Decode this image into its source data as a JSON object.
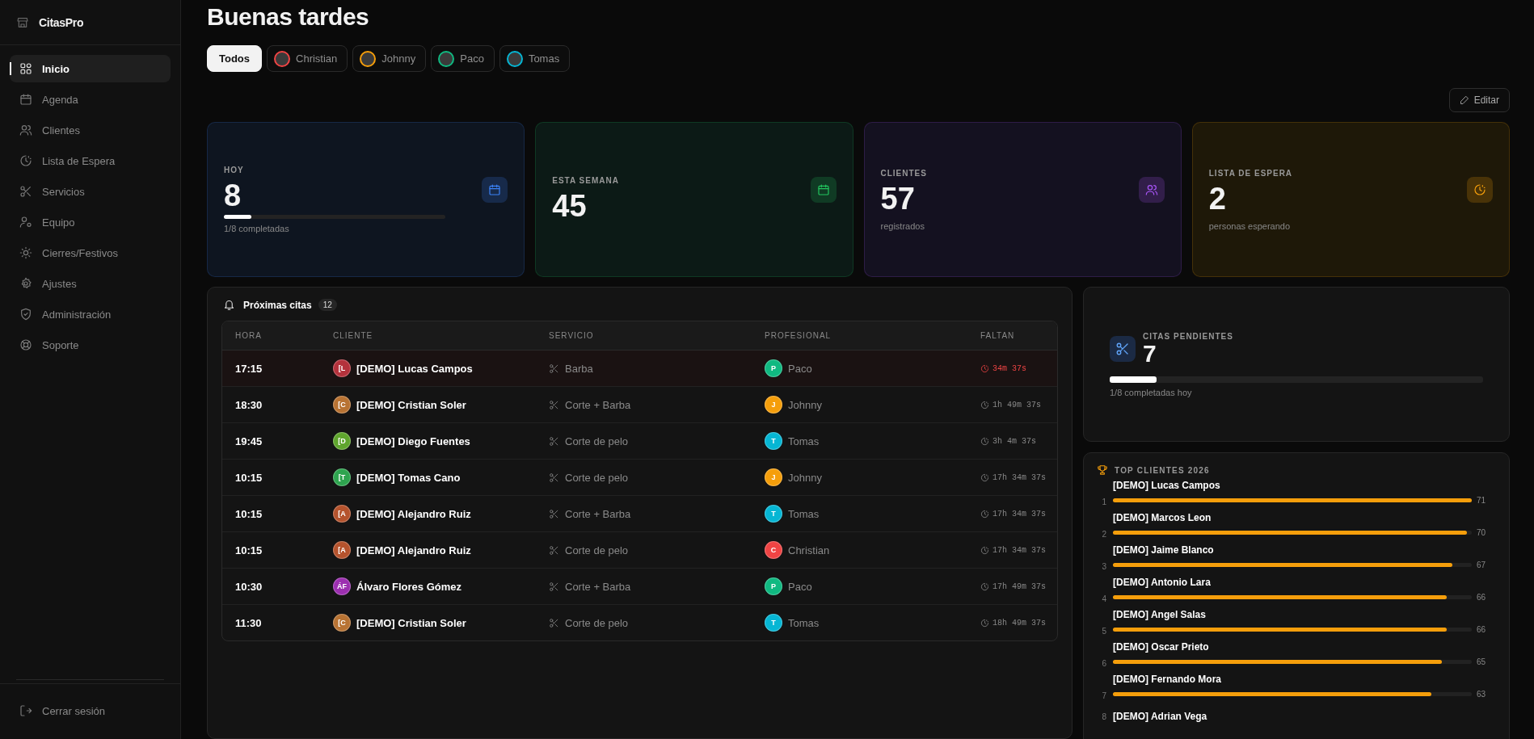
{
  "sidebar": {
    "brand": "CitasPro",
    "items": [
      {
        "label": "Inicio",
        "selected": true
      },
      {
        "label": "Agenda",
        "selected": false
      },
      {
        "label": "Clientes",
        "selected": false
      },
      {
        "label": "Lista de Espera",
        "selected": false
      },
      {
        "label": "Servicios",
        "selected": false
      },
      {
        "label": "Equipo",
        "selected": false
      },
      {
        "label": "Cierres/Festivos",
        "selected": false
      },
      {
        "label": "Ajustes",
        "selected": false
      },
      {
        "label": "Administración",
        "selected": false
      },
      {
        "label": "Soporte",
        "selected": false
      }
    ],
    "logout": "Cerrar sesión"
  },
  "header": {
    "title": "Buenas tardes",
    "edit_button": "Editar"
  },
  "filters": [
    {
      "label": "Todos",
      "selected": true
    },
    {
      "label": "Christian",
      "selected": false,
      "color": "#ef4444"
    },
    {
      "label": "Johnny",
      "selected": false,
      "color": "#f59e0b"
    },
    {
      "label": "Paco",
      "selected": false,
      "color": "#10b981"
    },
    {
      "label": "Tomas",
      "selected": false,
      "color": "#06b6d4"
    }
  ],
  "stats": [
    {
      "label": "HOY",
      "value": "8",
      "level": 0.125,
      "caption": "1/8 completadas",
      "color": "#3b82f6"
    },
    {
      "label": "ESTA SEMANA",
      "value": "45",
      "color": "#22c55e"
    },
    {
      "label": "CLIENTES",
      "value": "57",
      "caption": "registrados",
      "color": "#a855f7"
    },
    {
      "label": "LISTA DE ESPERA",
      "value": "2",
      "caption": "personas esperando",
      "color": "#f59e0b"
    }
  ],
  "upcoming": {
    "title": "Próximas citas",
    "count": "12",
    "columns": [
      "HORA",
      "CLIENTE",
      "SERVICIO",
      "PROFESIONAL",
      "FALTAN"
    ],
    "rows": [
      {
        "time": "17:15",
        "client": {
          "initials": "[L",
          "name": "[DEMO] Lucas Campos",
          "color": "#b4323c"
        },
        "service": "Barba",
        "professional": {
          "initial": "P",
          "name": "Paco",
          "color": "#10b981"
        },
        "remaining": "34m 37s",
        "urgent": true
      },
      {
        "time": "18:30",
        "client": {
          "initials": "[C",
          "name": "[DEMO] Cristian Soler",
          "color": "#b87333"
        },
        "service": "Corte + Barba",
        "professional": {
          "initial": "J",
          "name": "Johnny",
          "color": "#f59e0b"
        },
        "remaining": "1h 49m 37s",
        "urgent": false
      },
      {
        "time": "19:45",
        "client": {
          "initials": "[D",
          "name": "[DEMO] Diego Fuentes",
          "color": "#5fa52d"
        },
        "service": "Corte de pelo",
        "professional": {
          "initial": "T",
          "name": "Tomas",
          "color": "#06b6d4"
        },
        "remaining": "3h 4m 37s",
        "urgent": false
      },
      {
        "time": "10:15",
        "client": {
          "initials": "[T",
          "name": "[DEMO] Tomas Cano",
          "color": "#2ea44f"
        },
        "service": "Corte de pelo",
        "professional": {
          "initial": "J",
          "name": "Johnny",
          "color": "#f59e0b"
        },
        "remaining": "17h 34m 37s",
        "urgent": false
      },
      {
        "time": "10:15",
        "client": {
          "initials": "[A",
          "name": "[DEMO] Alejandro Ruiz",
          "color": "#b5532d"
        },
        "service": "Corte + Barba",
        "professional": {
          "initial": "T",
          "name": "Tomas",
          "color": "#06b6d4"
        },
        "remaining": "17h 34m 37s",
        "urgent": false
      },
      {
        "time": "10:15",
        "client": {
          "initials": "[A",
          "name": "[DEMO] Alejandro Ruiz",
          "color": "#b5532d"
        },
        "service": "Corte de pelo",
        "professional": {
          "initial": "C",
          "name": "Christian",
          "color": "#ef4444"
        },
        "remaining": "17h 34m 37s",
        "urgent": false
      },
      {
        "time": "10:30",
        "client": {
          "initials": "ÁF",
          "name": "Álvaro Flores Gómez",
          "color": "#9c2fb0"
        },
        "service": "Corte + Barba",
        "professional": {
          "initial": "P",
          "name": "Paco",
          "color": "#10b981"
        },
        "remaining": "17h 49m 37s",
        "urgent": false
      },
      {
        "time": "11:30",
        "client": {
          "initials": "[C",
          "name": "[DEMO] Cristian Soler",
          "color": "#b87333"
        },
        "service": "Corte de pelo",
        "professional": {
          "initial": "T",
          "name": "Tomas",
          "color": "#06b6d4"
        },
        "remaining": "18h 49m 37s",
        "urgent": false
      }
    ]
  },
  "pending": {
    "label": "CITAS PENDIENTES",
    "value": "7",
    "level": 0.125,
    "caption": "1/8 completadas hoy"
  },
  "top_clients": {
    "title": "TOP CLIENTES 2026",
    "items": [
      {
        "rank": "1",
        "name": "[DEMO] Lucas Campos",
        "level": 1.0,
        "count": "71"
      },
      {
        "rank": "2",
        "name": "[DEMO] Marcos Leon",
        "level": 0.987,
        "count": "70"
      },
      {
        "rank": "3",
        "name": "[DEMO] Jaime Blanco",
        "level": 0.945,
        "count": "67"
      },
      {
        "rank": "4",
        "name": "[DEMO] Antonio Lara",
        "level": 0.93,
        "count": "66"
      },
      {
        "rank": "5",
        "name": "[DEMO] Angel Salas",
        "level": 0.93,
        "count": "66"
      },
      {
        "rank": "6",
        "name": "[DEMO] Oscar Prieto",
        "level": 0.916,
        "count": "65"
      },
      {
        "rank": "7",
        "name": "[DEMO] Fernando Mora",
        "level": 0.887,
        "count": "63"
      },
      {
        "rank": "8",
        "name": "[DEMO] Adrian Vega"
      }
    ]
  }
}
